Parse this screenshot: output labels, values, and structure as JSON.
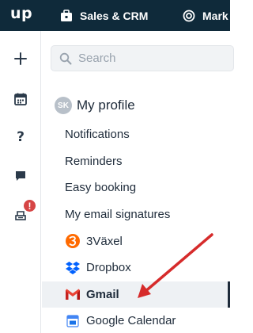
{
  "topbar": {
    "logo": "up",
    "nav": [
      {
        "label": "Sales & CRM",
        "icon": "briefcase-icon"
      },
      {
        "label": "Mark",
        "icon": "target-icon"
      }
    ]
  },
  "leftbar": {
    "items": [
      {
        "icon": "plus-icon"
      },
      {
        "icon": "calendar-icon"
      },
      {
        "icon": "help-icon",
        "glyph": "?"
      },
      {
        "icon": "chat-icon"
      },
      {
        "icon": "queue-icon",
        "badge": "!"
      }
    ]
  },
  "search": {
    "placeholder": "Search"
  },
  "profile": {
    "avatar_initials": "SK",
    "title": "My profile"
  },
  "menu": [
    {
      "label": "Notifications"
    },
    {
      "label": "Reminders"
    },
    {
      "label": "Easy booking"
    },
    {
      "label": "My email signatures"
    },
    {
      "label": "3Växel",
      "icon": "3vaxel-icon"
    },
    {
      "label": "Dropbox",
      "icon": "dropbox-icon"
    },
    {
      "label": "Gmail",
      "icon": "gmail-icon",
      "active": true
    },
    {
      "label": "Google Calendar",
      "icon": "google-calendar-icon"
    }
  ],
  "colors": {
    "topbar": "#0f2a3a",
    "arrow": "#d62b2b",
    "badge": "#d64545",
    "dropbox": "#0061fe",
    "three_vaxel": "#ff6a00"
  }
}
